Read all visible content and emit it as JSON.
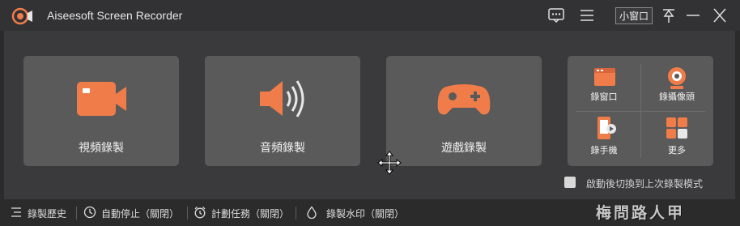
{
  "app": {
    "title": "Aiseesoft Screen Recorder"
  },
  "titlebar": {
    "mini_window_label": "小窗口"
  },
  "cards": [
    {
      "label": "視頻錄製",
      "icon": "video-camera-icon"
    },
    {
      "label": "音頻錄製",
      "icon": "speaker-icon"
    },
    {
      "label": "遊戲錄製",
      "icon": "gamepad-icon"
    }
  ],
  "grid": [
    {
      "label": "錄窗口",
      "icon": "window-icon"
    },
    {
      "label": "錄攝像頭",
      "icon": "webcam-icon"
    },
    {
      "label": "錄手機",
      "icon": "phone-icon"
    },
    {
      "label": "更多",
      "icon": "more-grid-icon"
    }
  ],
  "option": {
    "label": "啟動後切換到上次錄製模式"
  },
  "bottombar": {
    "history": "錄製歷史",
    "auto_stop": "自動停止（關閉）",
    "schedule": "計劃任務（關閉）",
    "watermark": "錄製水印（關閉）"
  },
  "overlay_watermark": "梅問路人甲",
  "colors": {
    "accent": "#f07c4a",
    "card": "#5a5a5a",
    "background": "#2b2b2c"
  }
}
